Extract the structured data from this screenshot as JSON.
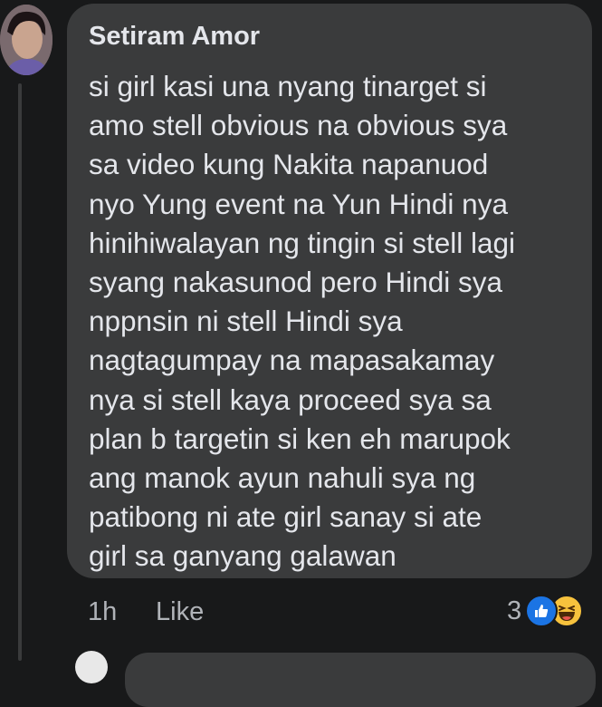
{
  "comment": {
    "author": "Setiram Amor",
    "lines": [
      "si girl kasi una nyang tinarget si",
      "amo stell obvious na obvious sya",
      "sa video kung Nakita napanuod",
      "nyo Yung event na Yun Hindi nya",
      "hinihiwalayan ng tingin si stell lagi",
      "syang nakasunod pero Hindi sya",
      "nppnsin ni stell Hindi sya",
      "nagtagumpay na mapasakamay",
      "nya si stell kaya proceed sya sa",
      "plan b targetin si ken eh marupok",
      "ang manok ayun nahuli sya ng",
      "patibong ni ate girl sanay si ate",
      "girl sa ganyang galawan"
    ],
    "time": "1h",
    "like_label": "Like",
    "reaction_count": "3",
    "reaction_icons": [
      "like-icon",
      "haha-icon"
    ]
  },
  "colors": {
    "background": "#18191a",
    "bubble": "#3a3b3c",
    "text": "#e4e6eb",
    "secondary_text": "#b0b3b8",
    "like_blue": "#1b74e4",
    "haha_yellow": "#f7c23d"
  }
}
